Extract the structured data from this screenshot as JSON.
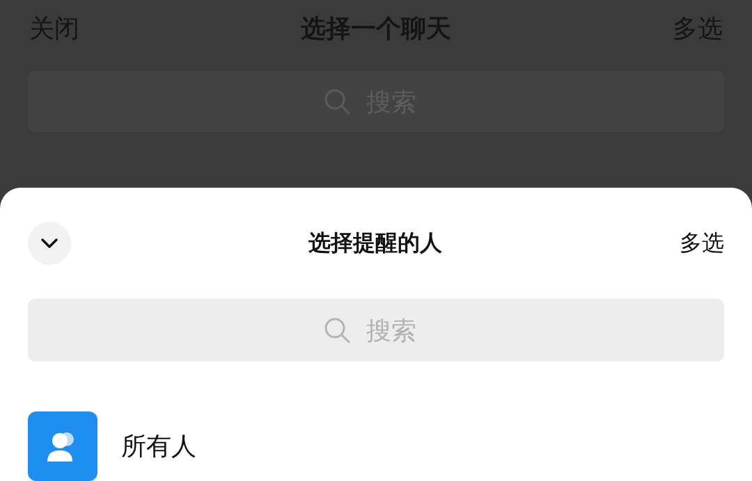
{
  "background": {
    "top_bar": {
      "close": "关闭",
      "title": "选择一个聊天",
      "multi_select": "多选"
    },
    "search": {
      "placeholder": "搜索"
    }
  },
  "sheet": {
    "title": "选择提醒的人",
    "multi_select": "多选",
    "search": {
      "placeholder": "搜索"
    },
    "members": [
      {
        "name": "所有人",
        "kind": "all"
      }
    ]
  }
}
